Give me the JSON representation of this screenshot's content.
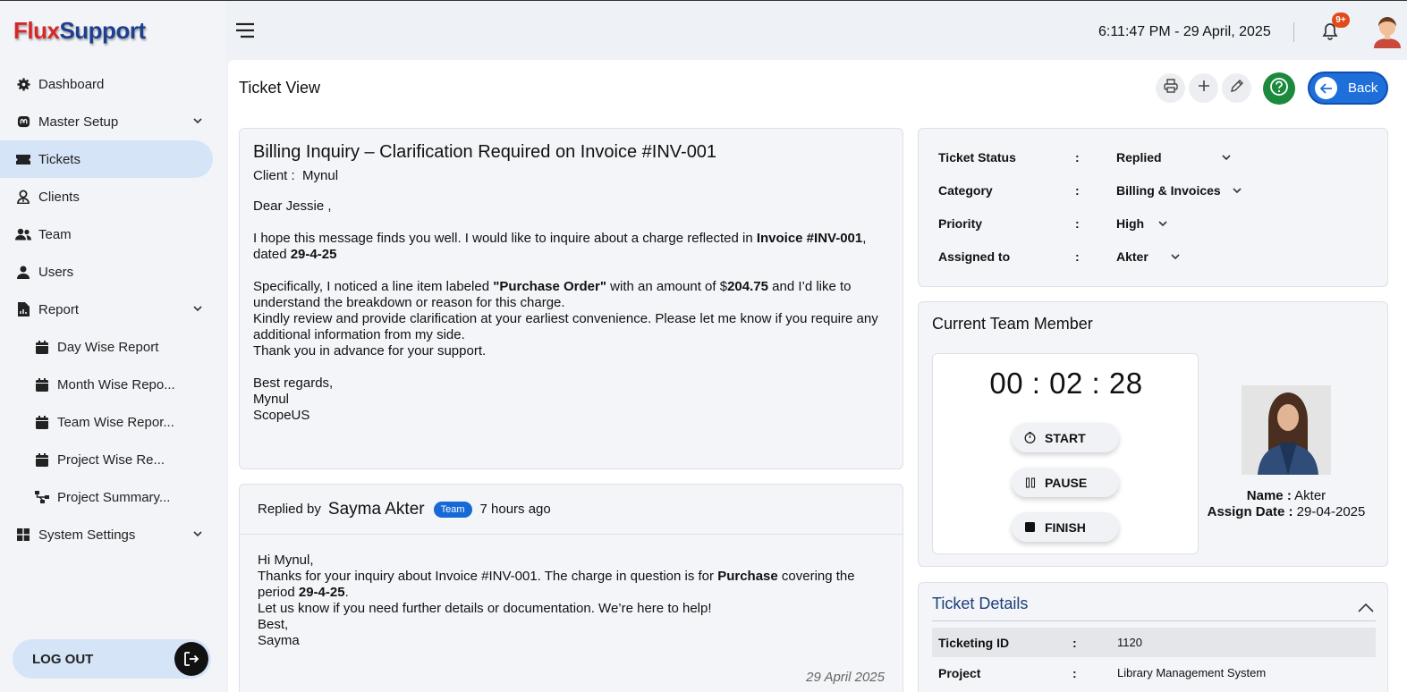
{
  "app": {
    "logo_part1": "Flux",
    "logo_part2": "Support"
  },
  "sidebar": {
    "items": [
      {
        "label": "Dashboard",
        "icon": "gear-icon"
      },
      {
        "label": "Master Setup",
        "icon": "mastodon-icon"
      },
      {
        "label": "Tickets",
        "icon": "ticket-icon"
      },
      {
        "label": "Clients",
        "icon": "user-tie-icon"
      },
      {
        "label": "Team",
        "icon": "users-icon"
      },
      {
        "label": "Users",
        "icon": "user-icon"
      },
      {
        "label": "Report",
        "icon": "file-report-icon"
      },
      {
        "label": "Day Wise Report",
        "icon": "calendar-icon"
      },
      {
        "label": "Month Wise Repo...",
        "icon": "calendar-icon"
      },
      {
        "label": "Team Wise Repor...",
        "icon": "calendar-icon"
      },
      {
        "label": "Project Wise Re...",
        "icon": "calendar-icon"
      },
      {
        "label": "Project Summary...",
        "icon": "sitemap-icon"
      },
      {
        "label": "System Settings",
        "icon": "windows-icon"
      }
    ],
    "logout_label": "LOG OUT"
  },
  "topbar": {
    "datetime": "6:11:47 PM - 29 April, 2025",
    "notifications_badge": "9+"
  },
  "page": {
    "title": "Ticket View",
    "back_label": "Back"
  },
  "email": {
    "subject": "Billing Inquiry – Clarification Required on Invoice #INV-001",
    "client_label": "Client :",
    "client_name": "Mynul",
    "greeting": "Dear  Jessie ,",
    "p1_a": "I hope this message finds you well. I would like to inquire about a charge reflected in ",
    "p1_b": "Invoice #INV-001",
    "p1_c": ", dated ",
    "p1_d": "29-4-25",
    "p2_a": "Specifically, I noticed a line item labeled ",
    "p2_b": "\"Purchase Order\"",
    "p2_c": " with an amount of $",
    "p2_d": "204.75",
    "p2_e": "  and I’d like to understand the breakdown or reason for this charge.",
    "p2_f": "Kindly review and provide clarification at your earliest convenience. Please let me know if you require any additional information from my side.",
    "p2_g": "Thank you in advance for your support.",
    "sign1": "Best regards,",
    "sign2": "Mynul",
    "sign3": "ScopeUS"
  },
  "reply": {
    "replied_by_label": "Replied by",
    "name": "Sayma Akter",
    "badge": "Team",
    "time_ago": "7 hours ago",
    "l1": "Hi Mynul,",
    "l2_a": "Thanks for your inquiry about Invoice #INV-001. The charge in question is for ",
    "l2_b": "Purchase",
    "l2_c": " covering the period ",
    "l2_d": "29-4-25",
    "l2_e": ".",
    "l3": "Let us know if you need further details or documentation. We’re here to help!",
    "l4": "Best,",
    "l5": "Sayma",
    "date": "29 April 2025"
  },
  "status": {
    "rows": [
      {
        "label": "Ticket Status",
        "value": "Replied"
      },
      {
        "label": "Category",
        "value": "Billing & Invoices"
      },
      {
        "label": "Priority",
        "value": "High"
      },
      {
        "label": "Assigned to",
        "value": "Akter"
      }
    ],
    "colon": ":"
  },
  "team_member": {
    "title": "Current Team Member",
    "timer": "00 : 02 : 28",
    "start": "START",
    "pause": "PAUSE",
    "finish": "FINISH",
    "name_label": "Name :",
    "name": "Akter",
    "assign_label": "Assign Date :",
    "assign_date": "29-04-2025"
  },
  "ticket_details": {
    "title": "Ticket Details",
    "rows": [
      {
        "label": "Ticketing ID",
        "value": "1120"
      },
      {
        "label": "Project",
        "value": "Library Management System"
      }
    ],
    "colon": ":"
  },
  "colors": {
    "accent": "#1e6fd9",
    "active_nav": "#d6e4f7",
    "help": "#1c8a3c",
    "badge": "#e24a1a"
  }
}
